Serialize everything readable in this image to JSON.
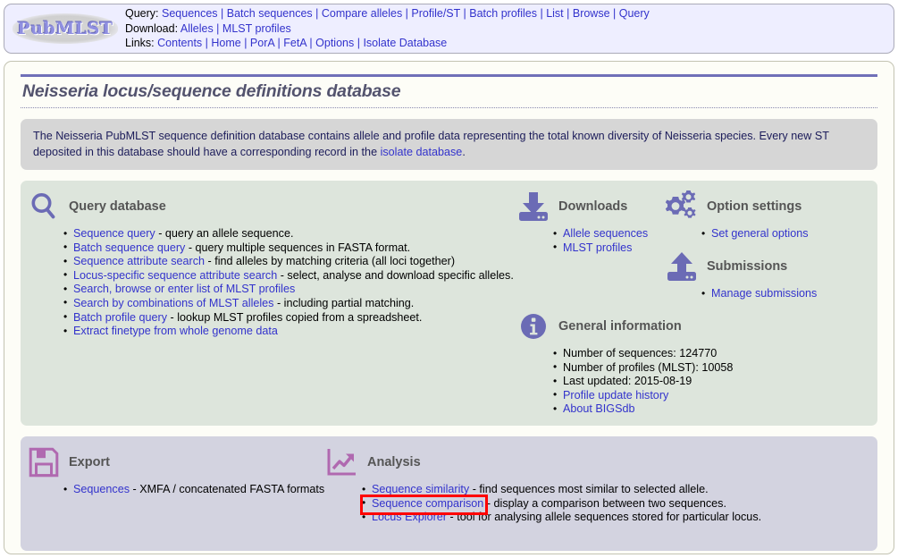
{
  "header": {
    "logo_text": "PubMLST",
    "rows": [
      {
        "label": "Query:",
        "items": [
          "Sequences",
          "Batch sequences",
          "Compare alleles",
          "Profile/ST",
          "Batch profiles",
          "List",
          "Browse",
          "Query"
        ]
      },
      {
        "label": "Download:",
        "items": [
          "Alleles",
          "MLST profiles"
        ]
      },
      {
        "label": "Links:",
        "items": [
          "Contents",
          "Home",
          "PorA",
          "FetA",
          "Options",
          "Isolate Database"
        ]
      }
    ]
  },
  "page": {
    "title": "Neisseria locus/sequence definitions database",
    "intro_pre": "The Neisseria PubMLST sequence definition database contains allele and profile data representing the total known diversity of Neisseria species. Every new ST deposited in this database should have a corresponding record in the ",
    "intro_link": "isolate database",
    "intro_post": "."
  },
  "query_database": {
    "icon": "magnifier-icon",
    "title": "Query database",
    "items": [
      {
        "link": "Sequence query",
        "text": " - query an allele sequence."
      },
      {
        "link": "Batch sequence query",
        "text": " - query multiple sequences in FASTA format."
      },
      {
        "link": "Sequence attribute search",
        "text": " - find alleles by matching criteria (all loci together)"
      },
      {
        "link": "Locus-specific sequence attribute search",
        "text": " - select, analyse and download specific alleles."
      },
      {
        "link": "Search, browse or enter list of MLST profiles",
        "text": ""
      },
      {
        "link": "Search by combinations of MLST alleles",
        "text": " - including partial matching."
      },
      {
        "link": "Batch profile query",
        "text": " - lookup MLST profiles copied from a spreadsheet."
      },
      {
        "link": "Extract finetype from whole genome data",
        "text": ""
      }
    ]
  },
  "downloads": {
    "icon": "download-icon",
    "title": "Downloads",
    "items": [
      {
        "link": "Allele sequences",
        "text": ""
      },
      {
        "link": "MLST profiles",
        "text": ""
      }
    ]
  },
  "option_settings": {
    "icon": "gears-icon",
    "title": "Option settings",
    "items": [
      {
        "link": "Set general options",
        "text": ""
      }
    ]
  },
  "submissions": {
    "icon": "upload-icon",
    "title": "Submissions",
    "items": [
      {
        "link": "Manage submissions",
        "text": ""
      }
    ]
  },
  "general_information": {
    "icon": "info-icon",
    "title": "General information",
    "items": [
      {
        "link": "",
        "text": "Number of sequences: 124770"
      },
      {
        "link": "",
        "text": "Number of profiles (MLST): 10058"
      },
      {
        "link": "",
        "text": "Last updated: 2015-08-19"
      },
      {
        "link": "Profile update history",
        "text": ""
      },
      {
        "link": "About BIGSdb",
        "text": ""
      }
    ]
  },
  "export": {
    "icon": "floppy-disk-icon",
    "title": "Export",
    "items": [
      {
        "link": "Sequences",
        "text": " - XMFA / concatenated FASTA formats"
      }
    ]
  },
  "analysis": {
    "icon": "chart-arrow-icon",
    "title": "Analysis",
    "items": [
      {
        "link": "Sequence similarity",
        "text": " - find sequences most similar to selected allele."
      },
      {
        "link": "Sequence comparison",
        "text": " - display a comparison between two sequences."
      },
      {
        "link": "Locus Explorer",
        "text": " - tool for analysing allele sequences stored for particular locus."
      }
    ]
  },
  "annotation": {
    "highlight_target": "Sequence comparison",
    "highlight_color": "#ff0000"
  },
  "colors": {
    "link": "#3333cc",
    "title": "#53536e",
    "accent_purple": "#7070b8",
    "icon_purple": "#6b6bb5",
    "icon_magenta": "#b069b0",
    "green_panel": "#dde5dc",
    "lavender_panel": "#d3d3e0",
    "intro_panel": "#d6d6d6",
    "header_bg": "#eeeeff"
  }
}
